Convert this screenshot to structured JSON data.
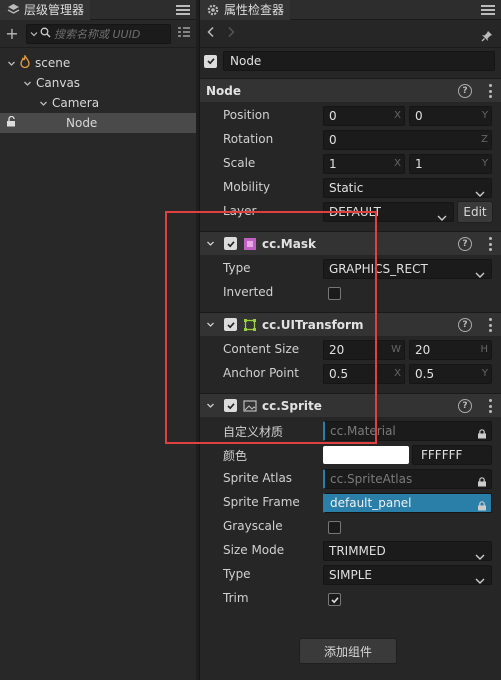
{
  "hierarchy": {
    "tab_title": "层级管理器",
    "search_placeholder": "搜索名称或 UUID",
    "nodes": [
      {
        "label": "scene"
      },
      {
        "label": "Canvas"
      },
      {
        "label": "Camera"
      },
      {
        "label": "Node"
      }
    ]
  },
  "inspector": {
    "tab_title": "属性检查器",
    "node_name": "Node",
    "node_section": {
      "title": "Node",
      "position": {
        "label": "Position",
        "x": "0",
        "y": "0",
        "x_axis": "X",
        "y_axis": "Y"
      },
      "rotation": {
        "label": "Rotation",
        "z": "0",
        "z_axis": "Z"
      },
      "scale": {
        "label": "Scale",
        "x": "1",
        "y": "1",
        "x_axis": "X",
        "y_axis": "Y"
      },
      "mobility": {
        "label": "Mobility",
        "value": "Static"
      },
      "layer": {
        "label": "Layer",
        "value": "DEFAULT",
        "edit_label": "Edit"
      }
    },
    "mask": {
      "title": "cc.Mask",
      "type": {
        "label": "Type",
        "value": "GRAPHICS_RECT"
      },
      "inverted": {
        "label": "Inverted",
        "checked": false
      }
    },
    "uitransform": {
      "title": "cc.UITransform",
      "content_size": {
        "label": "Content Size",
        "w": "20",
        "h": "20",
        "w_axis": "W",
        "h_axis": "H"
      },
      "anchor_point": {
        "label": "Anchor Point",
        "x": "0.5",
        "y": "0.5",
        "x_axis": "X",
        "y_axis": "Y"
      }
    },
    "sprite": {
      "title": "cc.Sprite",
      "custom_material": {
        "label": "自定义材质",
        "value": "cc.Material"
      },
      "color": {
        "label": "颜色",
        "hex": "FFFFFF"
      },
      "sprite_atlas": {
        "label": "Sprite Atlas",
        "value": "cc.SpriteAtlas"
      },
      "sprite_frame": {
        "label": "Sprite Frame",
        "value": "default_panel"
      },
      "grayscale": {
        "label": "Grayscale",
        "checked": false
      },
      "size_mode": {
        "label": "Size Mode",
        "value": "TRIMMED"
      },
      "type": {
        "label": "Type",
        "value": "SIMPLE"
      },
      "trim": {
        "label": "Trim",
        "checked": true
      }
    },
    "add_component_label": "添加组件"
  },
  "colors": {
    "accent_blue": "#2a7fa8",
    "highlight_red": "#e04040",
    "scene_orange": "#e8a040",
    "mask_pink": "#c060c0",
    "transform_green": "#9ad040"
  }
}
